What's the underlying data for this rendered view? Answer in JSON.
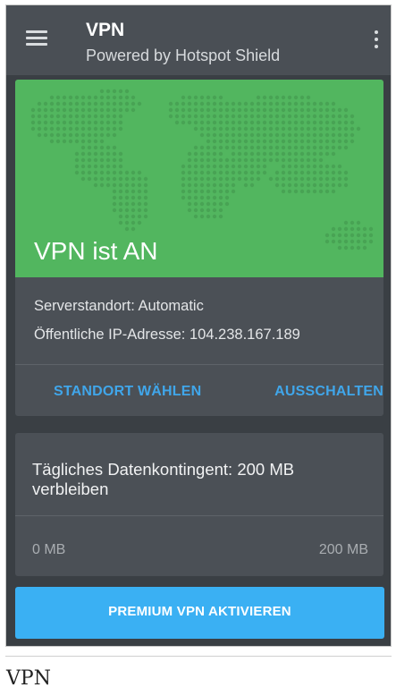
{
  "header": {
    "title": "VPN",
    "subtitle": "Powered by Hotspot Shield",
    "menu_icon": "hamburger-menu-icon",
    "more_icon": "more-vertical-icon"
  },
  "status_card": {
    "status": "VPN ist AN",
    "server_location": "Serverstandort: Automatic",
    "public_ip": "Öffentliche IP-Adresse: 104.238.167.189",
    "choose_location_label": "STANDORT WÄHLEN",
    "turn_off_label": "AUSSCHALTEN"
  },
  "data_card": {
    "title": "Tägliches Datenkontingent: 200 MB verbleiben",
    "min_label": "0 MB",
    "max_label": "200 MB"
  },
  "premium_button": {
    "label": "PREMIUM VPN AKTIVIEREN"
  },
  "caption": "VPN",
  "colors": {
    "app_bar": "#4a4f55",
    "background": "#3a3f44",
    "card": "#4b5056",
    "map_green": "#52b65f",
    "accent_blue": "#40a6ea",
    "premium_blue": "#3ab0f3"
  }
}
